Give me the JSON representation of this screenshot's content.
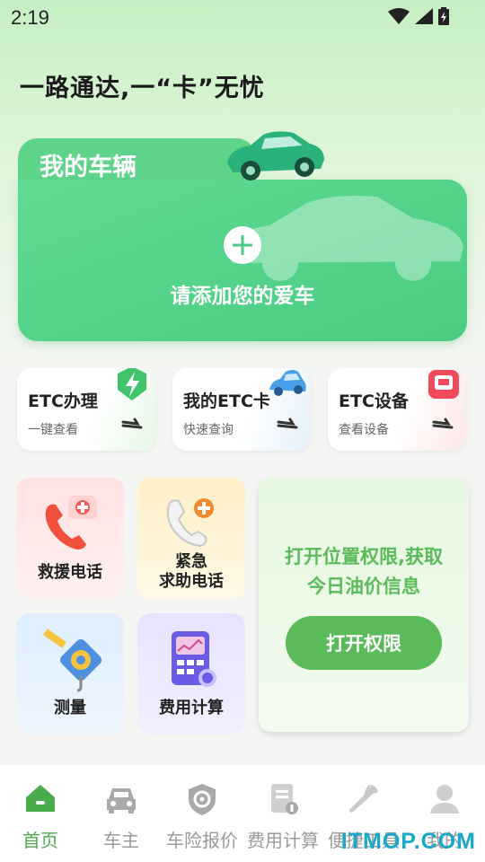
{
  "status": {
    "time": "2:19"
  },
  "slogan": "一路通达,一“卡”无忧",
  "vehicle": {
    "title": "我的车辆",
    "add_label": "请添加您的爱车"
  },
  "services": [
    {
      "title": "ETC办理",
      "subtitle": "一键查看",
      "icon": "lightning-icon"
    },
    {
      "title": "我的ETC卡",
      "subtitle": "快速查询",
      "icon": "car-icon"
    },
    {
      "title": "ETC设备",
      "subtitle": "查看设备",
      "icon": "device-icon"
    }
  ],
  "tools": {
    "rescue": "救援电话",
    "emergency_line1": "紧急",
    "emergency_line2": "求助电话",
    "measure": "测量",
    "fee": "费用计算"
  },
  "oil": {
    "line1": "打开位置权限,获取",
    "line2": "今日油价信息",
    "button": "打开权限"
  },
  "tabbar": [
    {
      "label": "首页",
      "icon": "home-icon",
      "active": true
    },
    {
      "label": "车主",
      "icon": "car-icon",
      "active": false
    },
    {
      "label": "车险报价",
      "icon": "shield-icon",
      "active": false
    },
    {
      "label": "费用计算",
      "icon": "bill-icon",
      "active": false
    },
    {
      "label": "便捷工具",
      "icon": "wrench-icon",
      "active": false
    },
    {
      "label": "我的",
      "icon": "user-icon",
      "active": false
    }
  ],
  "watermark": "ITMOP.COM",
  "colors": {
    "accent": "#5bbb5a",
    "vehicle_card": "#52d58a",
    "tab_active": "#4aab4d"
  }
}
